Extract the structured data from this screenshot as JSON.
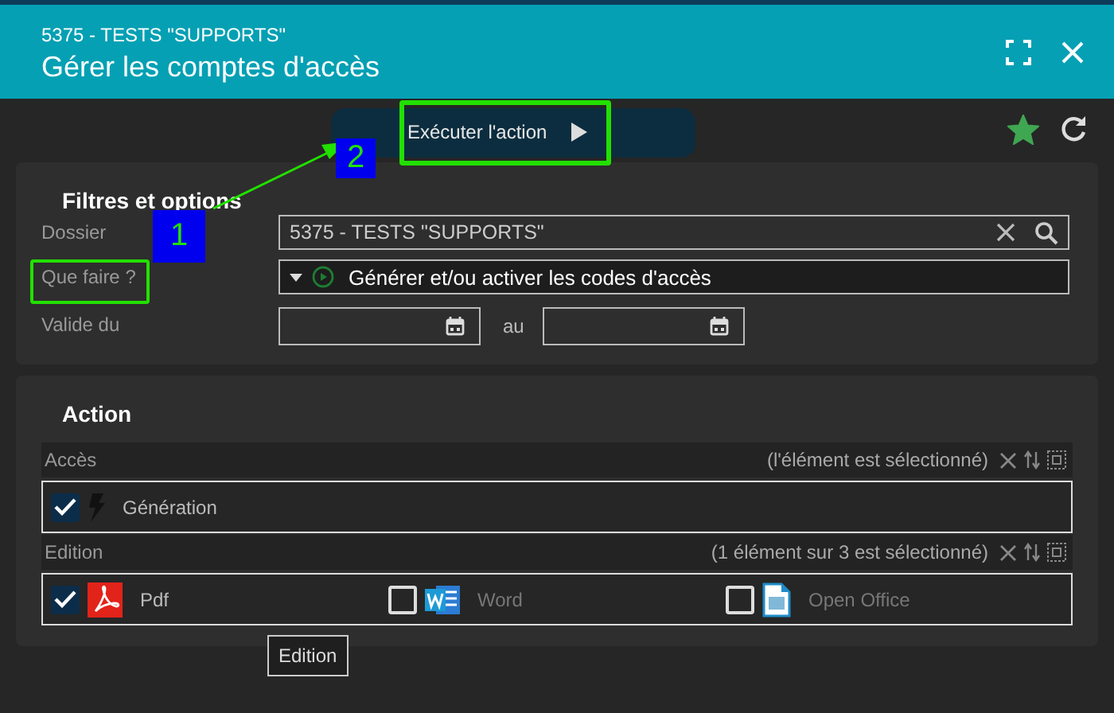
{
  "window": {
    "subtitle": "5375 - TESTS \"SUPPORTS\"",
    "title": "Gérer les comptes d'accès"
  },
  "toolbar": {
    "action_button": "Exécuter l'action",
    "favorite": true
  },
  "filters": {
    "title": "Filtres et options",
    "rows": [
      {
        "kind": "search",
        "label": "Dossier",
        "value": "5375 - TESTS \"SUPPORTS\""
      },
      {
        "kind": "select",
        "label": "Que faire ?",
        "value": "Générer et/ou activer les codes d'accès"
      },
      {
        "kind": "dates",
        "label": "Valide du",
        "between": "au"
      }
    ]
  },
  "action": {
    "title": "Action",
    "groups": [
      {
        "label": "Accès",
        "summary": "(l'élément est sélectionné)",
        "items": [
          {
            "label": "Génération",
            "checked": true
          }
        ]
      },
      {
        "label": "Edition",
        "summary": "(1 élément sur 3 est sélectionné)",
        "items": [
          {
            "label": "Pdf",
            "checked": true
          },
          {
            "label": "Word",
            "checked": false
          },
          {
            "label": "Open Office",
            "checked": false
          }
        ]
      }
    ]
  },
  "tooltip": "Edition",
  "annotations": [
    {
      "label": "1"
    },
    {
      "label": "2"
    }
  ]
}
